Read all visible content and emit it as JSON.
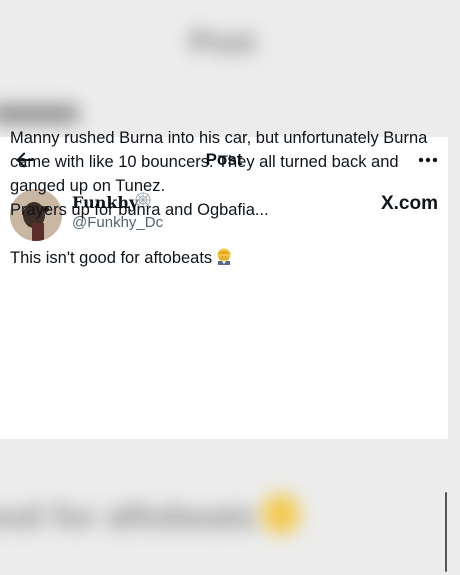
{
  "background": {
    "blurred_title": "Post",
    "blurred_text": "ood for aftobeats"
  },
  "header": {
    "title": "Post",
    "back_icon": "back-arrow-icon",
    "more_icon": "more-dots-icon"
  },
  "author": {
    "display_name": "Funkhy",
    "handle": "@Funkhy_Dc",
    "brand": "X.com"
  },
  "post": {
    "line1": "Manny rushed Burna into his car, but unfortunately Burna came with like 10 bouncers. They all turned back and ganged up on Tunez.",
    "line2": "Prayers up for bunra and Ogbafia...",
    "line3": "This isn't good for aftobeats",
    "emoji": "facepalm-emoji-icon"
  },
  "colors": {
    "text": "#0f1419",
    "secondary": "#536471",
    "background": "#ececec"
  }
}
